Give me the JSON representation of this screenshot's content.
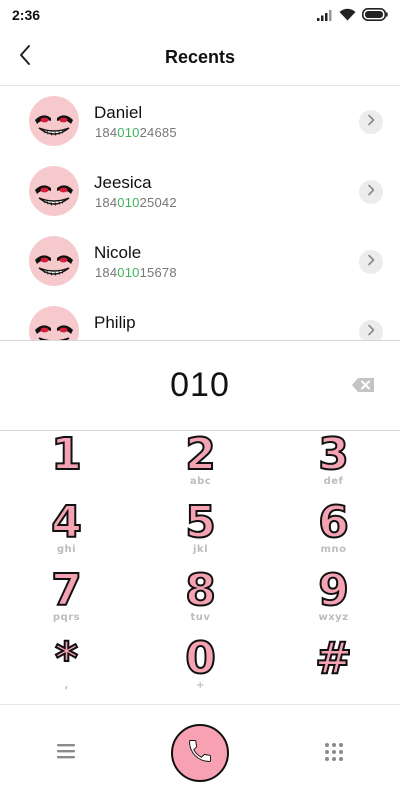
{
  "status_bar": {
    "time": "2:36"
  },
  "header": {
    "title": "Recents"
  },
  "recents": [
    {
      "name": "Daniel",
      "number_pre": "184",
      "number_match": "010",
      "number_post": "24685"
    },
    {
      "name": "Jeesica",
      "number_pre": "184",
      "number_match": "010",
      "number_post": "25042"
    },
    {
      "name": "Nicole",
      "number_pre": "184",
      "number_match": "010",
      "number_post": "15678"
    },
    {
      "name": "Philip",
      "number_pre": "",
      "number_match": "",
      "number_post": ""
    }
  ],
  "dial": {
    "entered": "010"
  },
  "keypad": [
    {
      "digit": "1",
      "letters": ""
    },
    {
      "digit": "2",
      "letters": "abc"
    },
    {
      "digit": "3",
      "letters": "def"
    },
    {
      "digit": "4",
      "letters": "ghi"
    },
    {
      "digit": "5",
      "letters": "jkl"
    },
    {
      "digit": "6",
      "letters": "mno"
    },
    {
      "digit": "7",
      "letters": "pqrs"
    },
    {
      "digit": "8",
      "letters": "tuv"
    },
    {
      "digit": "9",
      "letters": "wxyz"
    },
    {
      "digit": "*",
      "letters": ","
    },
    {
      "digit": "0",
      "letters": "+"
    },
    {
      "digit": "#",
      "letters": ""
    }
  ],
  "icons": {
    "back": "chevron-left-icon",
    "detail": "chevron-right-icon",
    "backspace": "backspace-icon",
    "menu": "menu-icon",
    "call": "phone-icon",
    "keypad": "dialpad-icon"
  },
  "colors": {
    "accent_pink": "#f7a1b3",
    "match_green": "#3fb35b",
    "avatar_bg": "#f6c9cc"
  }
}
